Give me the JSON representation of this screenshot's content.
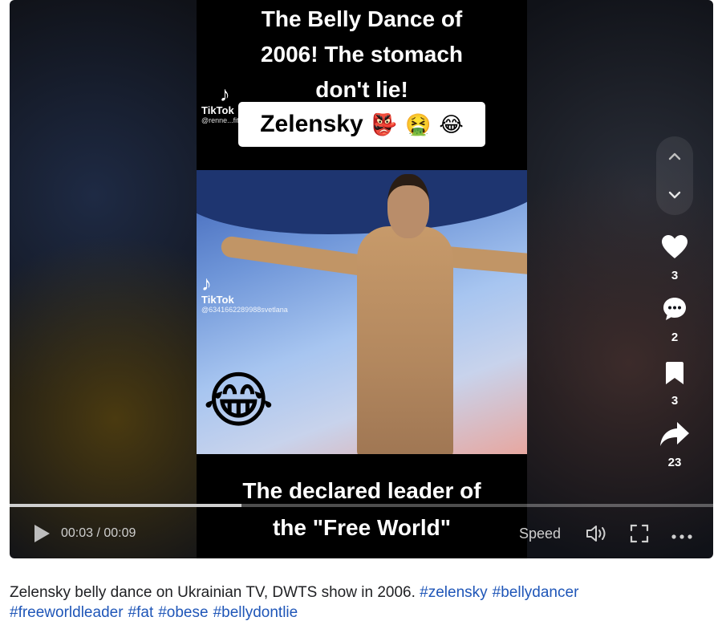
{
  "video": {
    "caption_top_lines": [
      "The Belly Dance of",
      "2006! The stomach",
      "don't lie!"
    ],
    "label_text": "Zelensky",
    "label_emojis": [
      "👺",
      "🤮",
      "😂"
    ],
    "watermark1": {
      "name": "TikTok",
      "handle": "@renne...fitz..."
    },
    "watermark2": {
      "name": "TikTok",
      "handle": "@6341662289988svetlana"
    },
    "overlay_emoji": "😂",
    "caption_bottom_lines": [
      "The declared leader of",
      "the \"Free World\""
    ]
  },
  "actions": {
    "likes": "3",
    "comments": "2",
    "bookmarks": "3",
    "shares": "23"
  },
  "player": {
    "time": "00:03 / 00:09",
    "progress": 0.33,
    "speed_label": "Speed"
  },
  "description": {
    "text": "Zelensky belly dance on Ukrainian TV, DWTS show in 2006.",
    "hashtags": [
      "#zelensky",
      "#bellydancer",
      "#freeworldleader",
      "#fat",
      "#obese",
      "#bellydontlie"
    ]
  },
  "colors": {
    "hashtag": "#1f56b8",
    "player_bg": "#101218",
    "video_bg": "#000000"
  },
  "icons": [
    "chevron-up-icon",
    "chevron-down-icon",
    "heart-icon",
    "comment-icon",
    "bookmark-icon",
    "share-icon",
    "play-icon",
    "volume-icon",
    "fullscreen-icon",
    "more-icon"
  ]
}
